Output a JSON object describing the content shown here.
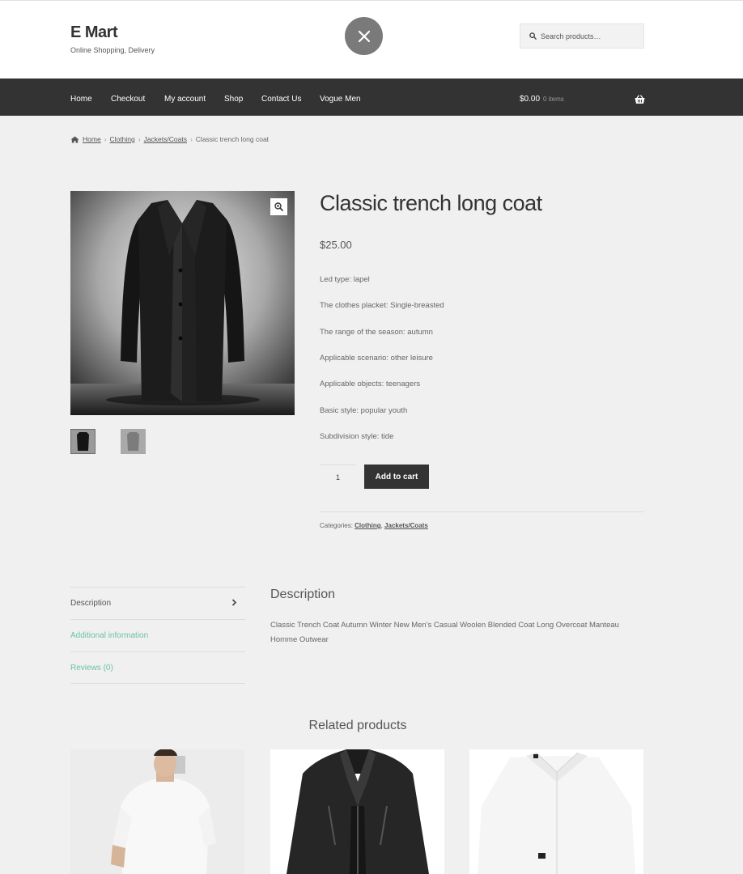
{
  "site": {
    "title": "E Mart",
    "tagline": "Online Shopping, Delivery"
  },
  "search": {
    "placeholder": "Search products…"
  },
  "nav": {
    "items": [
      "Home",
      "Checkout",
      "My account",
      "Shop",
      "Contact Us",
      "Vogue Men"
    ]
  },
  "cart": {
    "total": "$0.00",
    "count": "0 items"
  },
  "breadcrumb": {
    "home": "Home",
    "clothing": "Clothing",
    "jackets": "Jackets/Coats",
    "current": "Classic trench long coat"
  },
  "product": {
    "title": "Classic trench long coat",
    "price": "$25.00",
    "specs": [
      "Led type: lapel",
      "The clothes placket: Single-breasted",
      "The range of the season: autumn",
      "Applicable scenario: other leisure",
      "Applicable objects: teenagers",
      "Basic style: popular youth",
      "Subdivision style: tide"
    ],
    "quantity": "1",
    "add_to_cart": "Add to cart",
    "categories_label": "Categories:",
    "category_1": "Clothing",
    "category_2": "Jackets/Coats"
  },
  "tabs": {
    "description": "Description",
    "additional": "Additional information",
    "reviews": "Reviews (0)"
  },
  "description": {
    "heading": "Description",
    "text": "Classic Trench Coat Autumn Winter New Men's Casual Woolen Blended Coat Long Overcoat Manteau Homme Outwear"
  },
  "related": {
    "title": "Related products"
  },
  "colors": {
    "nav_bg": "#333333",
    "accent": "#6dc3a1",
    "page_bg": "#f0f0f0"
  },
  "icons": [
    "close-icon",
    "search-icon",
    "basket-icon",
    "home-icon",
    "zoom-icon",
    "chevron-right-icon"
  ]
}
